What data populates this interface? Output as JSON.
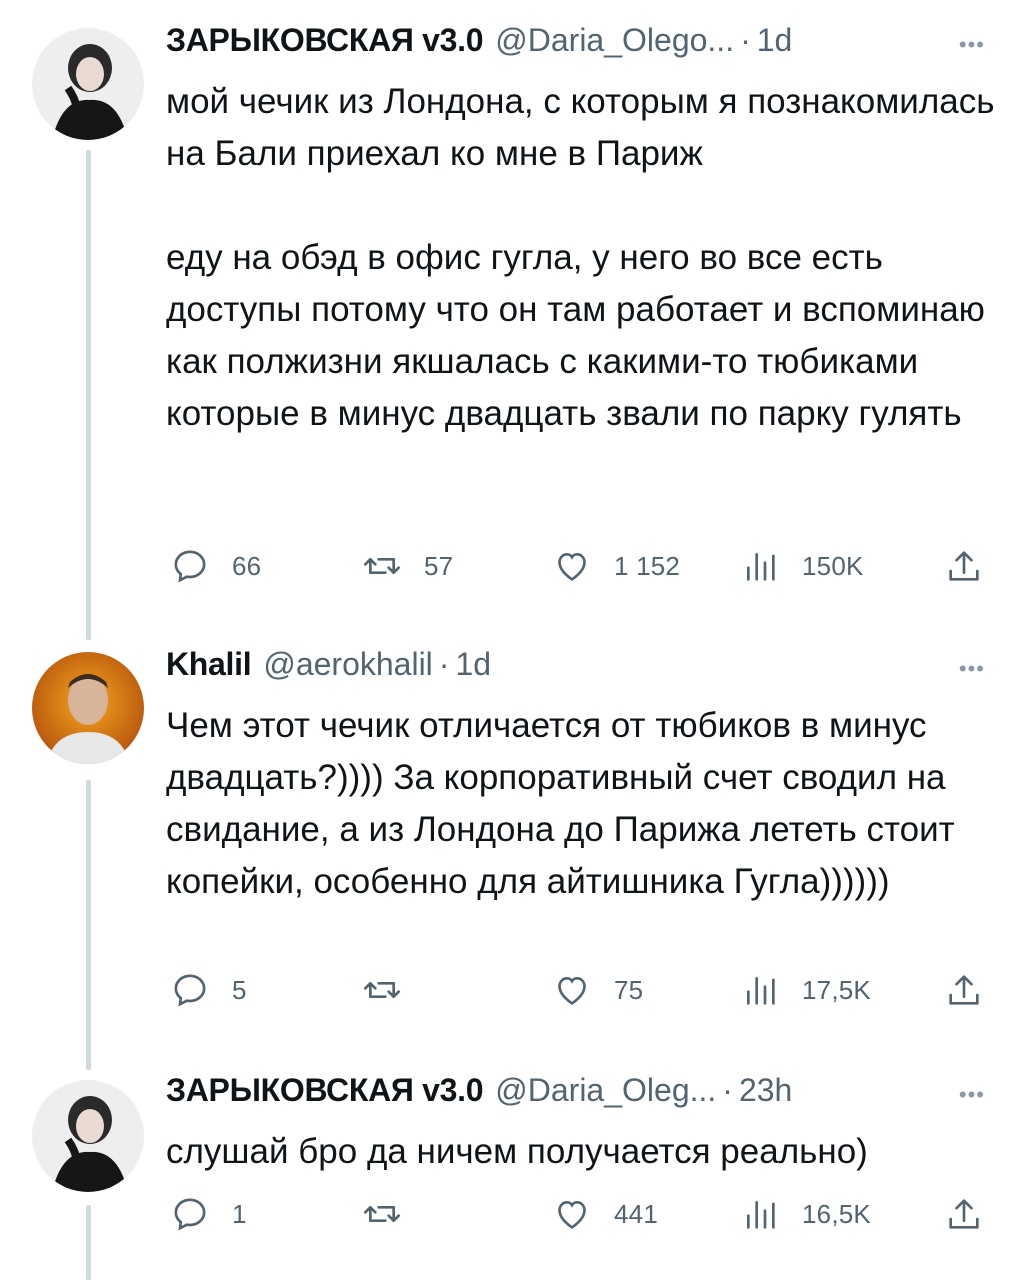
{
  "tweets": [
    {
      "name": "ЗАРЫКОВСКАЯ v3.0",
      "handle": "@Daria_Olego...",
      "time": "1d",
      "text": "мой чечик из Лондона, с которым я познакомилась на Бали приехал ко мне в Париж\n\nеду на обэд в офис гугла, у него во все есть доступы потому что он там работает и вспоминаю как полжизни якшалась с какими-то тюбиками которые в минус двадцать звали по парку гулять",
      "replies": "66",
      "retweets": "57",
      "likes": "1 152",
      "views": "150K"
    },
    {
      "name": "Khalil",
      "handle": "@aerokhalil",
      "time": "1d",
      "text": "Чем этот чечик отличается от тюбиков в минус двадцать?)))) За корпоративный счет сводил на свидание, а из Лондона до Парижа лететь стоит копейки, особенно для айтишника Гугла))))))",
      "replies": "5",
      "retweets": "",
      "likes": "75",
      "views": "17,5K"
    },
    {
      "name": "ЗАРЫКОВСКАЯ v3.0",
      "handle": "@Daria_Oleg...",
      "time": "23h",
      "text": "слушай бро да ничем получается реально)",
      "replies": "1",
      "retweets": "",
      "likes": "441",
      "views": "16,5K"
    }
  ],
  "ui": {
    "separator": "·",
    "more": "•••"
  },
  "icons": {
    "reply": "reply-icon",
    "retweet": "retweet-icon",
    "like": "heart-icon",
    "views": "views-icon",
    "share": "share-icon"
  },
  "colors": {
    "text": "#0f1419",
    "muted": "#536471",
    "thread_line": "#cfd9de"
  }
}
